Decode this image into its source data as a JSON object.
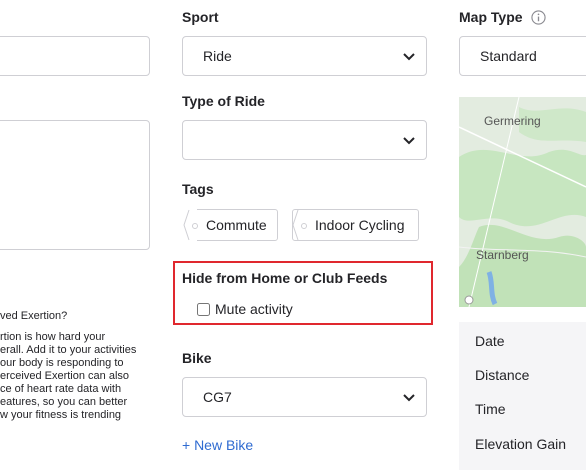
{
  "left": {
    "question": "ved Exertion?",
    "body_lines": [
      "rtion is how hard your",
      "erall. Add it to your activities",
      "our body is responding to",
      "erceived Exertion can also",
      "ce of heart rate data with",
      "eatures, so you can better",
      "w your fitness is trending"
    ]
  },
  "sport": {
    "label": "Sport",
    "value": "Ride"
  },
  "ride_type": {
    "label": "Type of Ride",
    "value": ""
  },
  "tags": {
    "label": "Tags",
    "items": [
      "Commute",
      "Indoor Cycling"
    ]
  },
  "hide_feeds": {
    "label": "Hide from Home or Club Feeds",
    "checkbox_label": "Mute activity",
    "checked": false,
    "highlight_color": "#e0282e"
  },
  "bike": {
    "label": "Bike",
    "value": "CG7",
    "add_label": "+ New Bike"
  },
  "map": {
    "label": "Map Type",
    "value": "Standard",
    "places": [
      "Germering",
      "Starnberg"
    ]
  },
  "stats": [
    "Date",
    "Distance",
    "Time",
    "Elevation Gain"
  ],
  "colors": {
    "link": "#2f6bd1",
    "map_green": "#c7e6c0",
    "panel_bg": "#f5f5f7"
  }
}
